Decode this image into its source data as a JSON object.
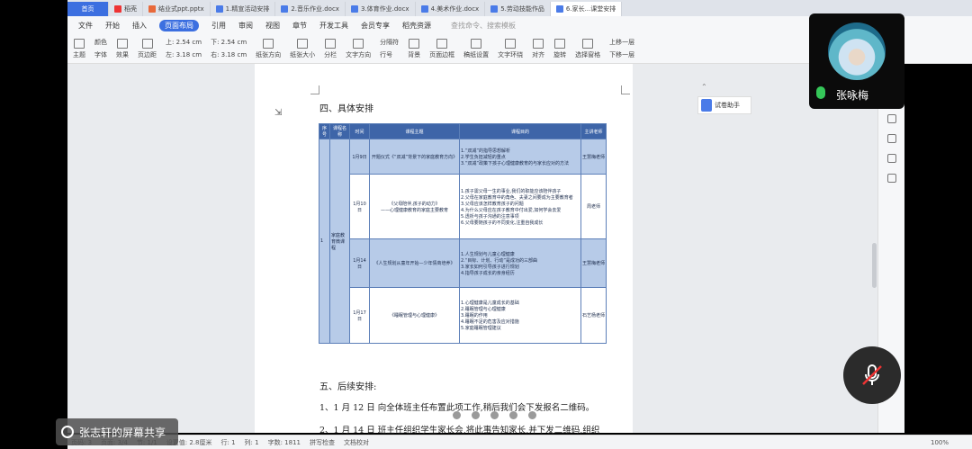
{
  "tabs": [
    {
      "label": "首页",
      "type": "home"
    },
    {
      "label": "稻壳",
      "type": "wps"
    },
    {
      "label": "结业式ppt.pptx",
      "type": "ppt"
    },
    {
      "label": "1.精宣活动安排",
      "type": "doc"
    },
    {
      "label": "2.音乐作业.docx",
      "type": "doc"
    },
    {
      "label": "3.体育作业.docx",
      "type": "doc"
    },
    {
      "label": "4.美术作业.docx",
      "type": "doc"
    },
    {
      "label": "5.劳动技能作品",
      "type": "doc"
    },
    {
      "label": "6.家长...课堂安排",
      "type": "doc",
      "active": true
    }
  ],
  "menu": [
    "文件",
    "开始",
    "插入",
    "页面布局",
    "引用",
    "审阅",
    "视图",
    "章节",
    "开发工具",
    "会员专享",
    "稻壳资源"
  ],
  "menu_active": "页面布局",
  "search_placeholder": "查找命令、搜索模板",
  "ribbon": {
    "theme": "主题",
    "color": "颜色",
    "font": "字体",
    "effect": "效果",
    "margin": "页边距",
    "top_label": "上:",
    "top_value": "2.54 cm",
    "bottom_label": "下:",
    "bottom_value": "2.54 cm",
    "left_label": "左:",
    "left_value": "3.18 cm",
    "right_label": "右:",
    "right_value": "3.18 cm",
    "orientation": "纸张方向",
    "size": "纸张大小",
    "columns": "分栏",
    "text_dir": "文字方向",
    "lines": "行号",
    "breaks": "分隔符",
    "background": "背景",
    "border": "页面边框",
    "paper_settings": "稿纸设置",
    "wrap": "文字环绕",
    "align": "对齐",
    "rotate": "旋转",
    "select_pane": "选择窗格",
    "up": "上移一层",
    "down": "下移一层"
  },
  "helper": {
    "label": "试卷助手"
  },
  "doc": {
    "heading4": "四、具体安排",
    "heading5": "五、后续安排:",
    "para1": "1、1 月 12 日  向全体班主任布置此项工作,稍后我们会下发报名二维码。",
    "para2": "2、1 月 14 日   班主任组织学生家长会,将此事告知家长,并下发二维码,组织"
  },
  "table": {
    "headers": [
      "序号",
      "课程名称",
      "时间",
      "课程主题",
      "课程目的",
      "主讲老师"
    ],
    "index": "1",
    "course": "家庭教育微课程",
    "rows": [
      {
        "time": "1月9日",
        "topic": "开题仪式《“双减”背景下的家庭教育方向》",
        "goal": "1.“双减”的指导思想解析\n2.学生负担减轻的重点\n3.“双减”政策下孩子心理健康教育的与家长应对的方法",
        "teacher": "王慧梅老师",
        "style": "blue"
      },
      {
        "time": "1月10日",
        "topic": "《父母陪伴,孩子的动力》\n——心理健康教育的家庭主要教育",
        "goal": "1.孩子需父母一生的事业,我们的职能应该陪伴孩子\n2.父母在家庭教育中的角色、夫妻之间要成为主要教育者\n3.父母应该怎样教育孩子的问题\n4.为什么父母应在孩子教育中付出爱,如何学会去爱\n5.透析与孩子沟通的注意事项\n6.父母要随孩子的不同变化,注重自我成长",
        "teacher": "周老师",
        "style": "white"
      },
      {
        "time": "1月14日",
        "topic": "《人生规划从童年开始—少年情商培养》",
        "goal": "1.人生规划与儿童心理健康\n2.“目标、计划、行动”是成功的三部曲\n3.家长如何引导孩子进行规划\n4.指导孩子成长的亲身经历",
        "teacher": "王慧梅老师",
        "style": "blue"
      },
      {
        "time": "1月17日",
        "topic": "《睡眠管理与心理健康》",
        "goal": "1.心理健康是儿童成长的基础\n2.睡眠管理与心理健康\n3.睡眠的作用\n4.睡眠不足的危害及应对措施\n5.家庭睡眠管理建议",
        "teacher": "石艺杨老师",
        "style": "white"
      }
    ]
  },
  "status": {
    "pages": "页码: 3",
    "page": "页面: 3/4",
    "section": "节: 1/1",
    "setting": "设置值: 2.8厘米",
    "row": "行: 1",
    "col": "列: 1",
    "words": "字数: 1811",
    "spell": "拼写检查",
    "proof": "文档校对",
    "zoom": "100%"
  },
  "video": {
    "name": "张咏梅"
  },
  "share": {
    "label": "张志轩的屏幕共享"
  }
}
